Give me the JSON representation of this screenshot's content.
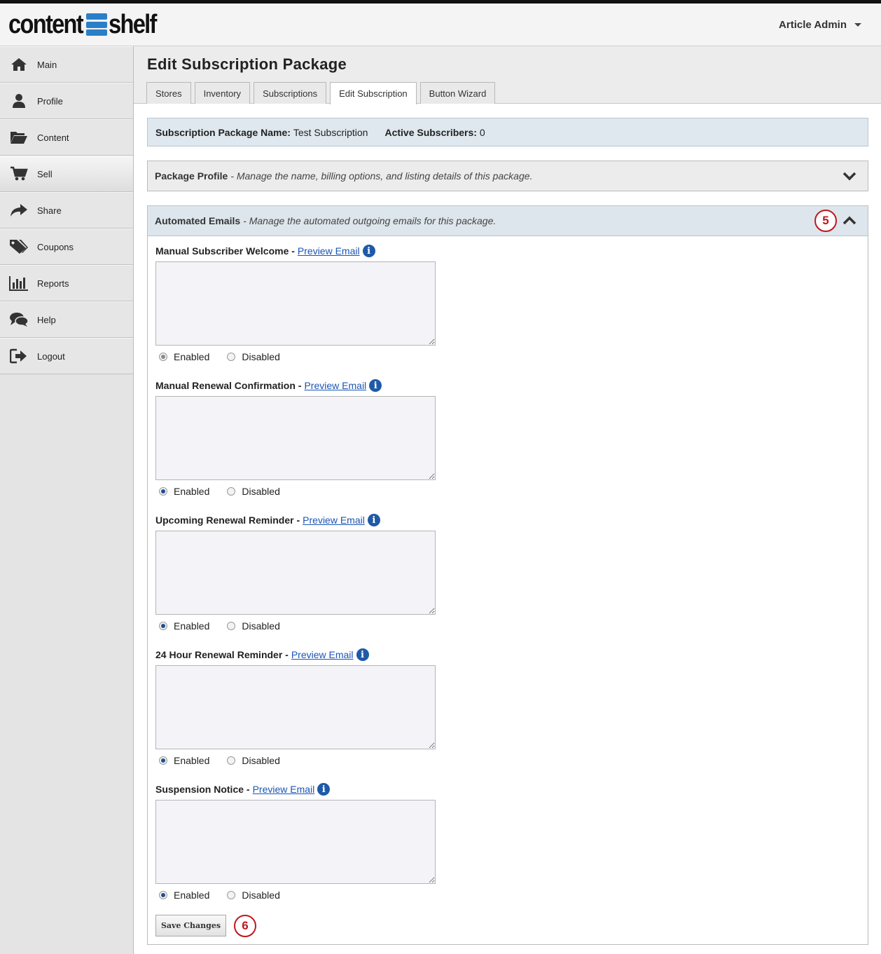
{
  "header": {
    "logo_left": "content",
    "logo_right": "shelf",
    "user_name": "Article Admin"
  },
  "sidebar": {
    "items": [
      {
        "label": "Main",
        "icon": "home-icon"
      },
      {
        "label": "Profile",
        "icon": "user-icon"
      },
      {
        "label": "Content",
        "icon": "folder-icon"
      },
      {
        "label": "Sell",
        "icon": "cart-icon",
        "active": true
      },
      {
        "label": "Share",
        "icon": "share-icon"
      },
      {
        "label": "Coupons",
        "icon": "tags-icon"
      },
      {
        "label": "Reports",
        "icon": "bar-chart-icon"
      },
      {
        "label": "Help",
        "icon": "chat-icon"
      },
      {
        "label": "Logout",
        "icon": "logout-icon"
      }
    ]
  },
  "page": {
    "title": "Edit Subscription Package",
    "tabs": [
      "Stores",
      "Inventory",
      "Subscriptions",
      "Edit Subscription",
      "Button Wizard"
    ],
    "active_tab": "Edit Subscription"
  },
  "summary": {
    "name_label": "Subscription Package Name:",
    "name_value": "Test Subscription",
    "subscribers_label": "Active Subscribers:",
    "subscribers_value": "0"
  },
  "package_profile": {
    "title": "Package Profile",
    "description": "- Manage the name, billing options, and listing details of this package."
  },
  "automated_emails": {
    "title": "Automated Emails",
    "description": "- Manage the automated outgoing emails for this package.",
    "marker": "5",
    "emails": [
      {
        "label": "Manual Subscriber Welcome -",
        "link": "Preview Email",
        "value": "",
        "enabled_label": "Enabled",
        "disabled_label": "Disabled",
        "state": "enabled"
      },
      {
        "label": "Manual Renewal Confirmation -",
        "link": "Preview Email",
        "value": "",
        "enabled_label": "Enabled",
        "disabled_label": "Disabled",
        "state": "enabled"
      },
      {
        "label": "Upcoming Renewal Reminder -",
        "link": "Preview Email",
        "value": "",
        "enabled_label": "Enabled",
        "disabled_label": "Disabled",
        "state": "enabled"
      },
      {
        "label": "24 Hour Renewal Reminder -",
        "link": "Preview Email",
        "value": "",
        "enabled_label": "Enabled",
        "disabled_label": "Disabled",
        "state": "enabled"
      },
      {
        "label": "Suspension Notice -",
        "link": "Preview Email",
        "value": "",
        "enabled_label": "Enabled",
        "disabled_label": "Disabled",
        "state": "enabled"
      }
    ],
    "save_label": "Save Changes",
    "save_marker": "6"
  },
  "colors": {
    "accent_blue": "#1f5aa6",
    "link_blue": "#1a56b5",
    "marker_red": "#c0161d",
    "logo_blue": "#2a7fc9"
  }
}
